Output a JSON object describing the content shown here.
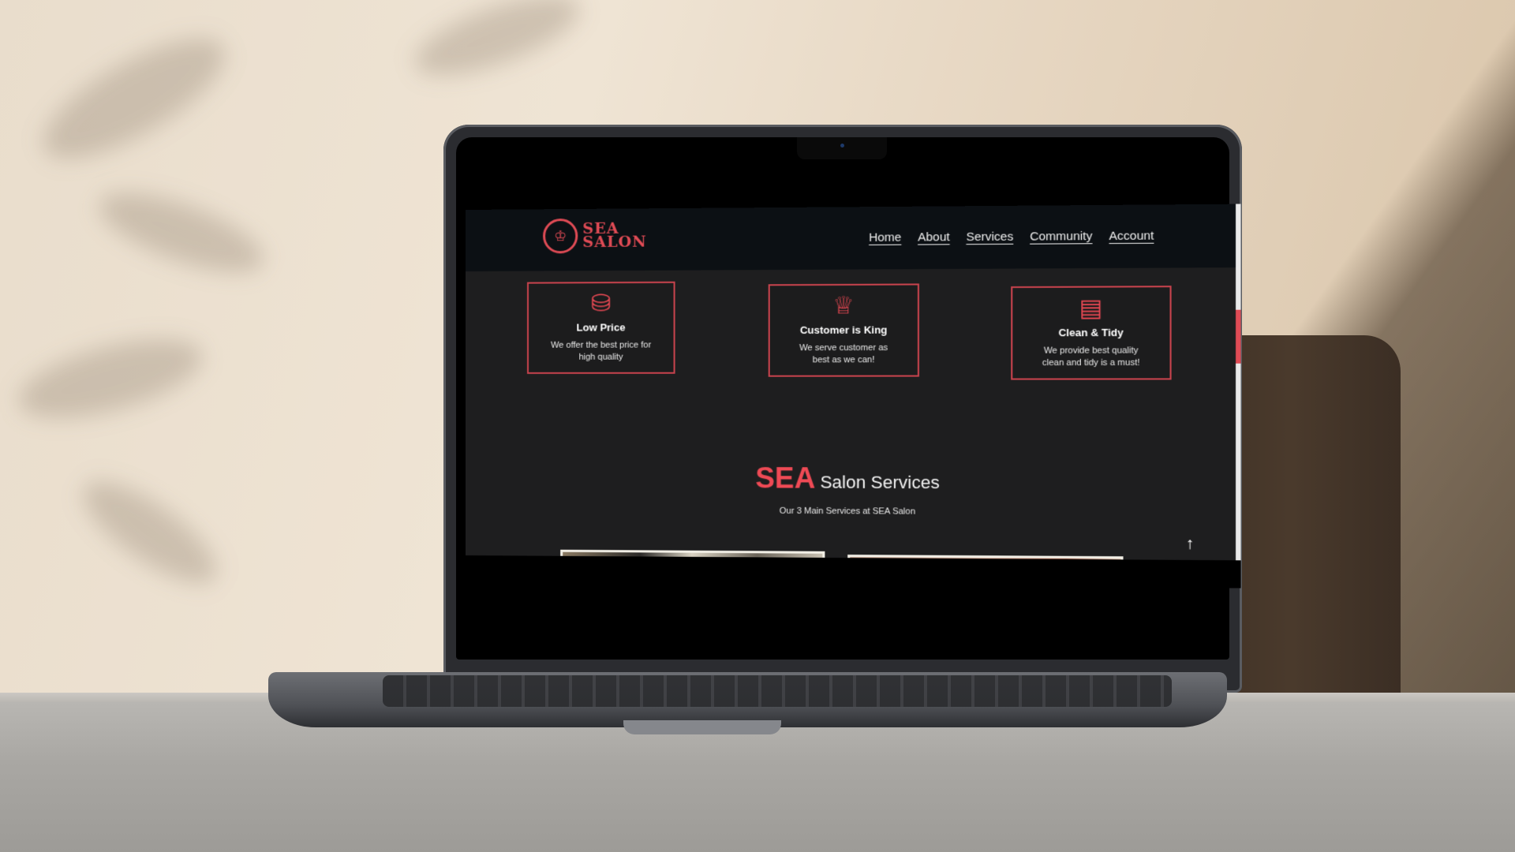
{
  "brand": {
    "line1": "SEA",
    "line2": "SALON"
  },
  "nav": [
    {
      "label": "Home"
    },
    {
      "label": "About"
    },
    {
      "label": "Services"
    },
    {
      "label": "Community"
    },
    {
      "label": "Account"
    }
  ],
  "features": [
    {
      "icon": "coins-icon",
      "title": "Low Price",
      "desc": "We offer the best price for high quality"
    },
    {
      "icon": "crown-icon",
      "title": "Customer is King",
      "desc": "We serve customer as best as we can!"
    },
    {
      "icon": "id-card-icon",
      "title": "Clean & Tidy",
      "desc": "We provide best quality clean and tidy is a must!"
    }
  ],
  "services": {
    "brand_word": "SEA",
    "title_rest": "Salon Services",
    "subtitle": "Our 3 Main Services at SEA Salon"
  },
  "colors": {
    "accent": "#ef4a55",
    "header_bg": "#0c1014",
    "page_bg": "#1e1e1f"
  },
  "scroll_top_icon": "arrow-up-icon"
}
